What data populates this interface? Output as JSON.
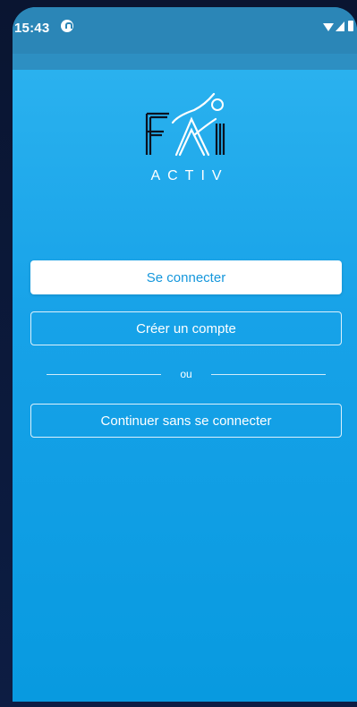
{
  "status_bar": {
    "time": "15:43",
    "icons": [
      "notification-icon",
      "wifi-icon",
      "signal-icon",
      "battery-icon"
    ]
  },
  "logo": {
    "brand_text": "ACTIV"
  },
  "actions": {
    "login_label": "Se connecter",
    "create_account_label": "Créer un compte",
    "separator_label": "ou",
    "continue_label": "Continuer sans se connecter"
  },
  "colors": {
    "background_top": "#2fb5f0",
    "background_bottom": "#089ae0",
    "status_bar": "#2b86b7",
    "primary_text": "#1597dc",
    "white": "#ffffff"
  }
}
